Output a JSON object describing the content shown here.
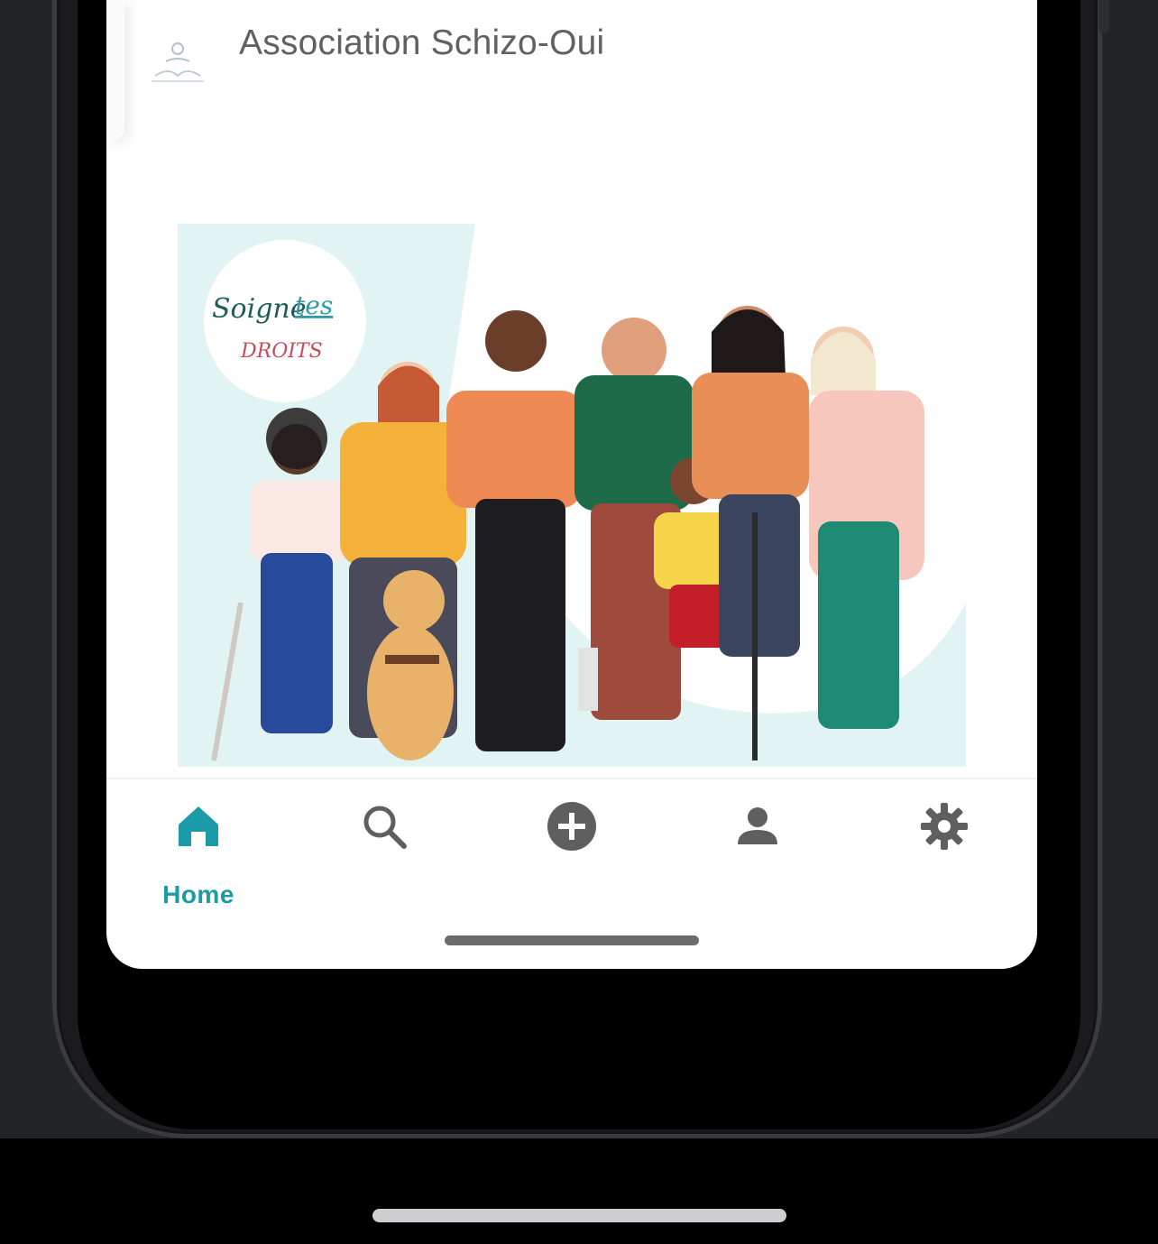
{
  "app": {
    "title": "Association Schizo-Oui"
  },
  "hero": {
    "badge_line1": "Soigne",
    "badge_line1_link": "tes",
    "badge_line2": "DROITS"
  },
  "bottom_nav": {
    "items": [
      {
        "id": "home",
        "icon": "home-icon",
        "label": "Home",
        "active": true
      },
      {
        "id": "search",
        "icon": "search-icon",
        "active": false
      },
      {
        "id": "add",
        "icon": "add-circle-icon",
        "active": false
      },
      {
        "id": "profile",
        "icon": "person-icon",
        "active": false
      },
      {
        "id": "settings",
        "icon": "gear-icon",
        "active": false
      }
    ]
  },
  "colors": {
    "accent": "#1b9aa8",
    "icon_inactive": "#5f5f5f",
    "hero_bg": "#e2f3f3"
  }
}
